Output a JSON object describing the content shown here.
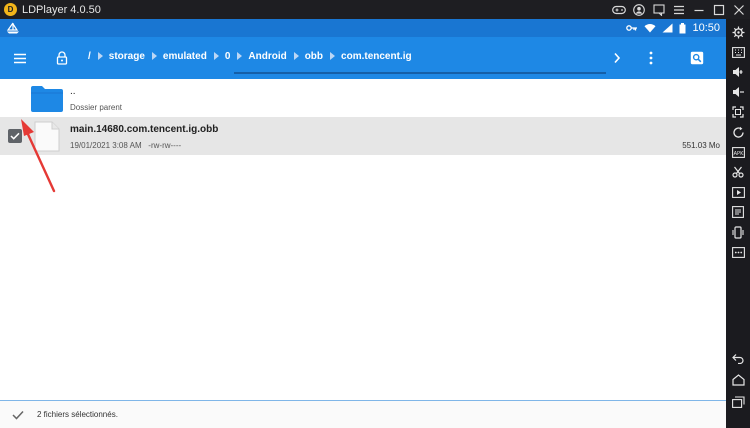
{
  "window": {
    "title": "LDPlayer 4.0.50",
    "logo_text": "D"
  },
  "status_bar": {
    "time": "10:50"
  },
  "toolbar": {
    "breadcrumb": [
      "/",
      "storage",
      "emulated",
      "0",
      "Android",
      "obb",
      "com.tencent.ig"
    ]
  },
  "rows": {
    "parent": {
      "name": "..",
      "subtitle": "Dossier parent"
    },
    "file": {
      "name": "main.14680.com.tencent.ig.obb",
      "date": "19/01/2021 3:08 AM",
      "permissions": "-rw-rw----",
      "size": "551.03 Mo",
      "checked": true
    }
  },
  "bottom_bar": {
    "selection_text": "2 fichiers sélectionnés."
  },
  "colors": {
    "toolbar": "#1e88e5",
    "status_bar": "#1976d2",
    "folder": "#1e88e5",
    "annotation_arrow": "#e53935"
  },
  "icons": {
    "titlebar": [
      "gamepad-icon",
      "user-icon",
      "chat-icon",
      "menu-icon",
      "minimize-icon",
      "maximize-icon",
      "close-icon"
    ],
    "sidebar": [
      "settings-icon",
      "keyboard-icon",
      "volume-up-icon",
      "volume-down-icon",
      "fullscreen-icon",
      "rotate-icon",
      "install-apk-icon",
      "screenshot-icon",
      "scissors-icon",
      "video-icon",
      "file-icon",
      "shake-icon",
      "more-icon",
      "back-icon",
      "home-icon",
      "recent-apps-icon"
    ]
  }
}
